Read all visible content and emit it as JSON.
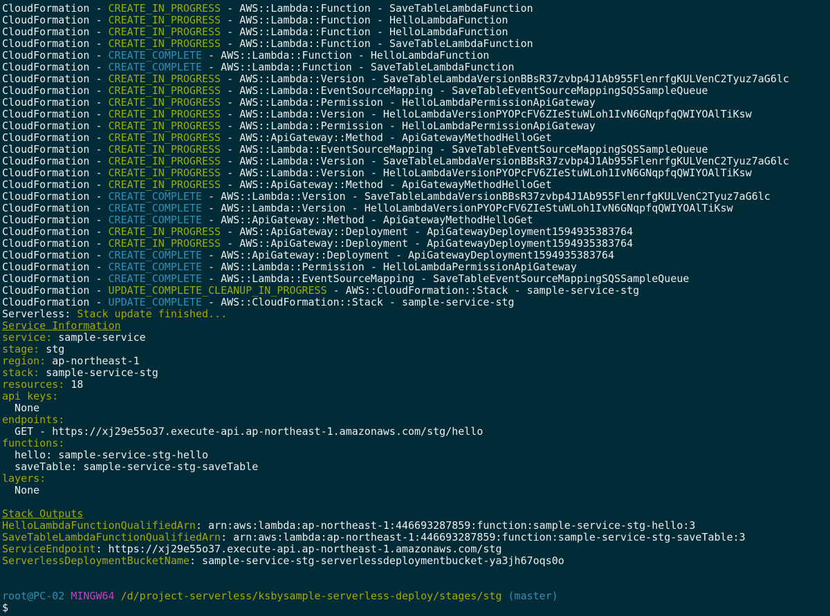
{
  "cf_lines": [
    {
      "src": "CloudFormation",
      "status": "CREATE_IN_PROGRESS",
      "kind": "in",
      "type": "AWS::Lambda::Function",
      "name": "SaveTableLambdaFunction"
    },
    {
      "src": "CloudFormation",
      "status": "CREATE_IN_PROGRESS",
      "kind": "in",
      "type": "AWS::Lambda::Function",
      "name": "HelloLambdaFunction"
    },
    {
      "src": "CloudFormation",
      "status": "CREATE_IN_PROGRESS",
      "kind": "in",
      "type": "AWS::Lambda::Function",
      "name": "HelloLambdaFunction"
    },
    {
      "src": "CloudFormation",
      "status": "CREATE_IN_PROGRESS",
      "kind": "in",
      "type": "AWS::Lambda::Function",
      "name": "SaveTableLambdaFunction"
    },
    {
      "src": "CloudFormation",
      "status": "CREATE_COMPLETE",
      "kind": "ok",
      "type": "AWS::Lambda::Function",
      "name": "HelloLambdaFunction"
    },
    {
      "src": "CloudFormation",
      "status": "CREATE_COMPLETE",
      "kind": "ok",
      "type": "AWS::Lambda::Function",
      "name": "SaveTableLambdaFunction"
    },
    {
      "src": "CloudFormation",
      "status": "CREATE_IN_PROGRESS",
      "kind": "in",
      "type": "AWS::Lambda::Version",
      "name": "SaveTableLambdaVersionBBsR37zvbp4J1Ab955FlenrfgKULVenC2Tyuz7aG6lc"
    },
    {
      "src": "CloudFormation",
      "status": "CREATE_IN_PROGRESS",
      "kind": "in",
      "type": "AWS::Lambda::EventSourceMapping",
      "name": "SaveTableEventSourceMappingSQSSampleQueue"
    },
    {
      "src": "CloudFormation",
      "status": "CREATE_IN_PROGRESS",
      "kind": "in",
      "type": "AWS::Lambda::Permission",
      "name": "HelloLambdaPermissionApiGateway"
    },
    {
      "src": "CloudFormation",
      "status": "CREATE_IN_PROGRESS",
      "kind": "in",
      "type": "AWS::Lambda::Version",
      "name": "HelloLambdaVersionPYOPcFV6ZIeStuWLoh1IvN6GNqpfqQWIYOAlTiKsw"
    },
    {
      "src": "CloudFormation",
      "status": "CREATE_IN_PROGRESS",
      "kind": "in",
      "type": "AWS::Lambda::Permission",
      "name": "HelloLambdaPermissionApiGateway"
    },
    {
      "src": "CloudFormation",
      "status": "CREATE_IN_PROGRESS",
      "kind": "in",
      "type": "AWS::ApiGateway::Method",
      "name": "ApiGatewayMethodHelloGet"
    },
    {
      "src": "CloudFormation",
      "status": "CREATE_IN_PROGRESS",
      "kind": "in",
      "type": "AWS::Lambda::EventSourceMapping",
      "name": "SaveTableEventSourceMappingSQSSampleQueue"
    },
    {
      "src": "CloudFormation",
      "status": "CREATE_IN_PROGRESS",
      "kind": "in",
      "type": "AWS::Lambda::Version",
      "name": "SaveTableLambdaVersionBBsR37zvbp4J1Ab955FlenrfgKULVenC2Tyuz7aG6lc"
    },
    {
      "src": "CloudFormation",
      "status": "CREATE_IN_PROGRESS",
      "kind": "in",
      "type": "AWS::Lambda::Version",
      "name": "HelloLambdaVersionPYOPcFV6ZIeStuWLoh1IvN6GNqpfqQWIYOAlTiKsw"
    },
    {
      "src": "CloudFormation",
      "status": "CREATE_IN_PROGRESS",
      "kind": "in",
      "type": "AWS::ApiGateway::Method",
      "name": "ApiGatewayMethodHelloGet"
    },
    {
      "src": "CloudFormation",
      "status": "CREATE_COMPLETE",
      "kind": "ok",
      "type": "AWS::Lambda::Version",
      "name": "SaveTableLambdaVersionBBsR37zvbp4J1Ab955FlenrfgKULVenC2Tyuz7aG6lc"
    },
    {
      "src": "CloudFormation",
      "status": "CREATE_COMPLETE",
      "kind": "ok",
      "type": "AWS::Lambda::Version",
      "name": "HelloLambdaVersionPYOPcFV6ZIeStuWLoh1IvN6GNqpfqQWIYOAlTiKsw"
    },
    {
      "src": "CloudFormation",
      "status": "CREATE_COMPLETE",
      "kind": "ok",
      "type": "AWS::ApiGateway::Method",
      "name": "ApiGatewayMethodHelloGet"
    },
    {
      "src": "CloudFormation",
      "status": "CREATE_IN_PROGRESS",
      "kind": "in",
      "type": "AWS::ApiGateway::Deployment",
      "name": "ApiGatewayDeployment1594935383764"
    },
    {
      "src": "CloudFormation",
      "status": "CREATE_IN_PROGRESS",
      "kind": "in",
      "type": "AWS::ApiGateway::Deployment",
      "name": "ApiGatewayDeployment1594935383764"
    },
    {
      "src": "CloudFormation",
      "status": "CREATE_COMPLETE",
      "kind": "ok",
      "type": "AWS::ApiGateway::Deployment",
      "name": "ApiGatewayDeployment1594935383764"
    },
    {
      "src": "CloudFormation",
      "status": "CREATE_COMPLETE",
      "kind": "ok",
      "type": "AWS::Lambda::Permission",
      "name": "HelloLambdaPermissionApiGateway"
    },
    {
      "src": "CloudFormation",
      "status": "CREATE_COMPLETE",
      "kind": "ok",
      "type": "AWS::Lambda::EventSourceMapping",
      "name": "SaveTableEventSourceMappingSQSSampleQueue"
    },
    {
      "src": "CloudFormation",
      "status": "UPDATE_COMPLETE_CLEANUP_IN_PROGRESS",
      "kind": "in",
      "type": "AWS::CloudFormation::Stack",
      "name": "sample-service-stg"
    },
    {
      "src": "CloudFormation",
      "status": "UPDATE_COMPLETE",
      "kind": "ok",
      "type": "AWS::CloudFormation::Stack",
      "name": "sample-service-stg"
    }
  ],
  "separator": " - ",
  "serverless_prefix": "Serverless: ",
  "serverless_message": "Stack update finished...",
  "service_info": {
    "heading": "Service Information",
    "service_key": "service:",
    "service_val": " sample-service",
    "stage_key": "stage:",
    "stage_val": " stg",
    "region_key": "region:",
    "region_val": " ap-northeast-1",
    "stack_key": "stack:",
    "stack_val": " sample-service-stg",
    "resources_key": "resources:",
    "resources_val": " 18",
    "api_keys_key": "api keys:",
    "api_keys_val": "  None",
    "endpoints_key": "endpoints:",
    "endpoints_val": "  GET - https://xj29e55o37.execute-api.ap-northeast-1.amazonaws.com/stg/hello",
    "functions_key": "functions:",
    "function_hello": "  hello: sample-service-stg-hello",
    "function_savetable": "  saveTable: sample-service-stg-saveTable",
    "layers_key": "layers:",
    "layers_val": "  None"
  },
  "stack_outputs": {
    "heading": "Stack Outputs",
    "items": [
      {
        "key": "HelloLambdaFunctionQualifiedArn",
        "val": ": arn:aws:lambda:ap-northeast-1:446693287859:function:sample-service-stg-hello:3"
      },
      {
        "key": "SaveTableLambdaFunctionQualifiedArn",
        "val": ": arn:aws:lambda:ap-northeast-1:446693287859:function:sample-service-stg-saveTable:3"
      },
      {
        "key": "ServiceEndpoint",
        "val": ": https://xj29e55o37.execute-api.ap-northeast-1.amazonaws.com/stg"
      },
      {
        "key": "ServerlessDeploymentBucketName",
        "val": ": sample-service-stg-serverlessdeploymentbucket-ya3jh67oqs0o"
      }
    ]
  },
  "prompt": {
    "user": "root@PC-02",
    "host": "MINGW64",
    "path": "/d/project-serverless/ksbysample-serverless-deploy/stages/stg",
    "branch": "(master)",
    "symbol": "$"
  },
  "colors": {
    "background": "#012b36",
    "in_progress": "#9aad00",
    "complete": "#2f8fb8",
    "key_olive": "#a7a800",
    "prompt_host": "#c040c0"
  }
}
